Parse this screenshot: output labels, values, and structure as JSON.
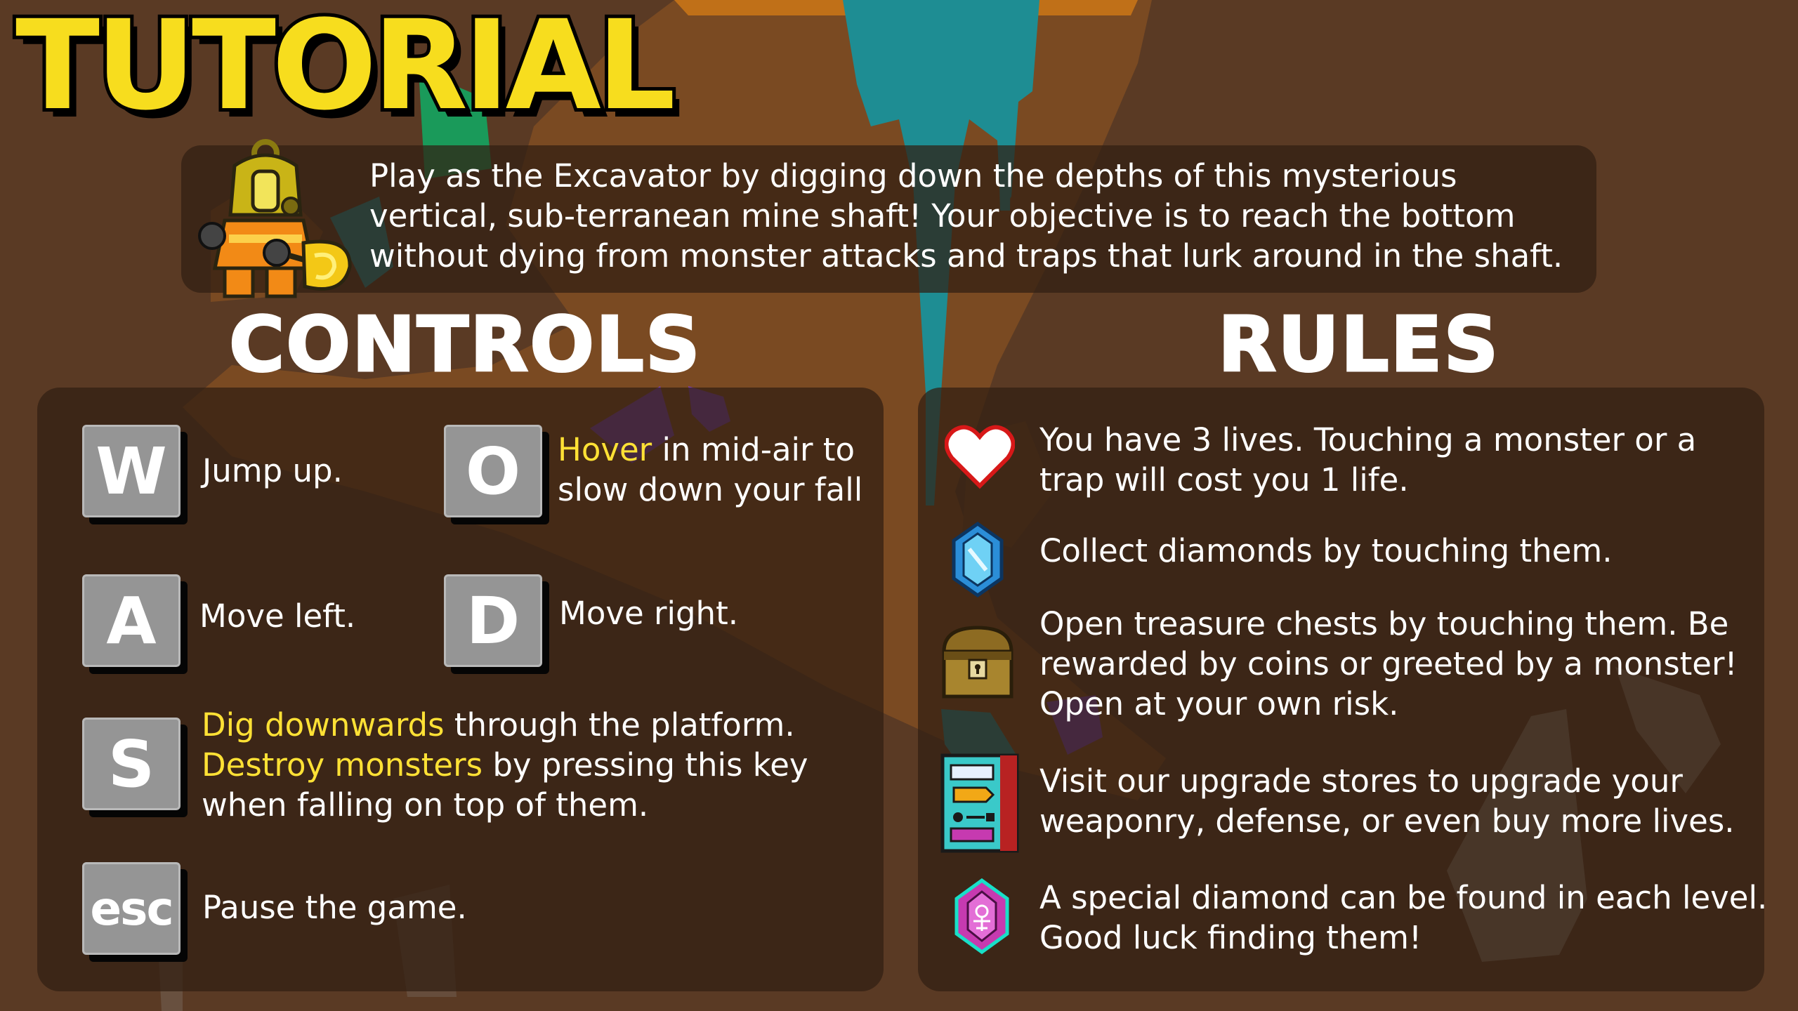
{
  "title": "TUTORIAL",
  "intro": "Play as the Excavator by digging down the depths of this mysterious vertical, sub-terranean mine shaft! Your objective is to reach the bottom without dying from monster attacks and traps that lurk around in the shaft.",
  "controls": {
    "heading": "CONTROLS",
    "keys": {
      "w": "W",
      "o": "O",
      "a": "A",
      "d": "D",
      "s": "S",
      "esc": "esc"
    },
    "w_text": "Jump up.",
    "o_highlight": "Hover",
    "o_text": " in mid-air to slow down your fall",
    "a_text": "Move left.",
    "d_text": "Move right.",
    "s_highlight1": "Dig downwards",
    "s_text1": " through the platform. ",
    "s_highlight2": "Destroy monsters",
    "s_text2": " by pressing this key when falling on top of them.",
    "esc_text": "Pause the game."
  },
  "rules": {
    "heading": "RULES",
    "items": [
      {
        "icon": "heart-icon",
        "text": "You have 3 lives. Touching a monster or a trap will cost you 1 life."
      },
      {
        "icon": "diamond-icon",
        "text": "Collect diamonds by touching them."
      },
      {
        "icon": "treasure-chest-icon",
        "text": "Open treasure chests by touching them. Be rewarded by coins or greeted by a monster! Open at your own risk."
      },
      {
        "icon": "upgrade-store-icon",
        "text": "Visit our upgrade stores to upgrade your weaponry, defense, or even buy more lives."
      },
      {
        "icon": "special-diamond-icon",
        "text": "A special diamond can be found in each level. Good luck finding them!"
      }
    ]
  },
  "colors": {
    "title": "#f7dd1e",
    "highlight": "#ffe135",
    "panel": "#301e12",
    "key": "#959595"
  }
}
